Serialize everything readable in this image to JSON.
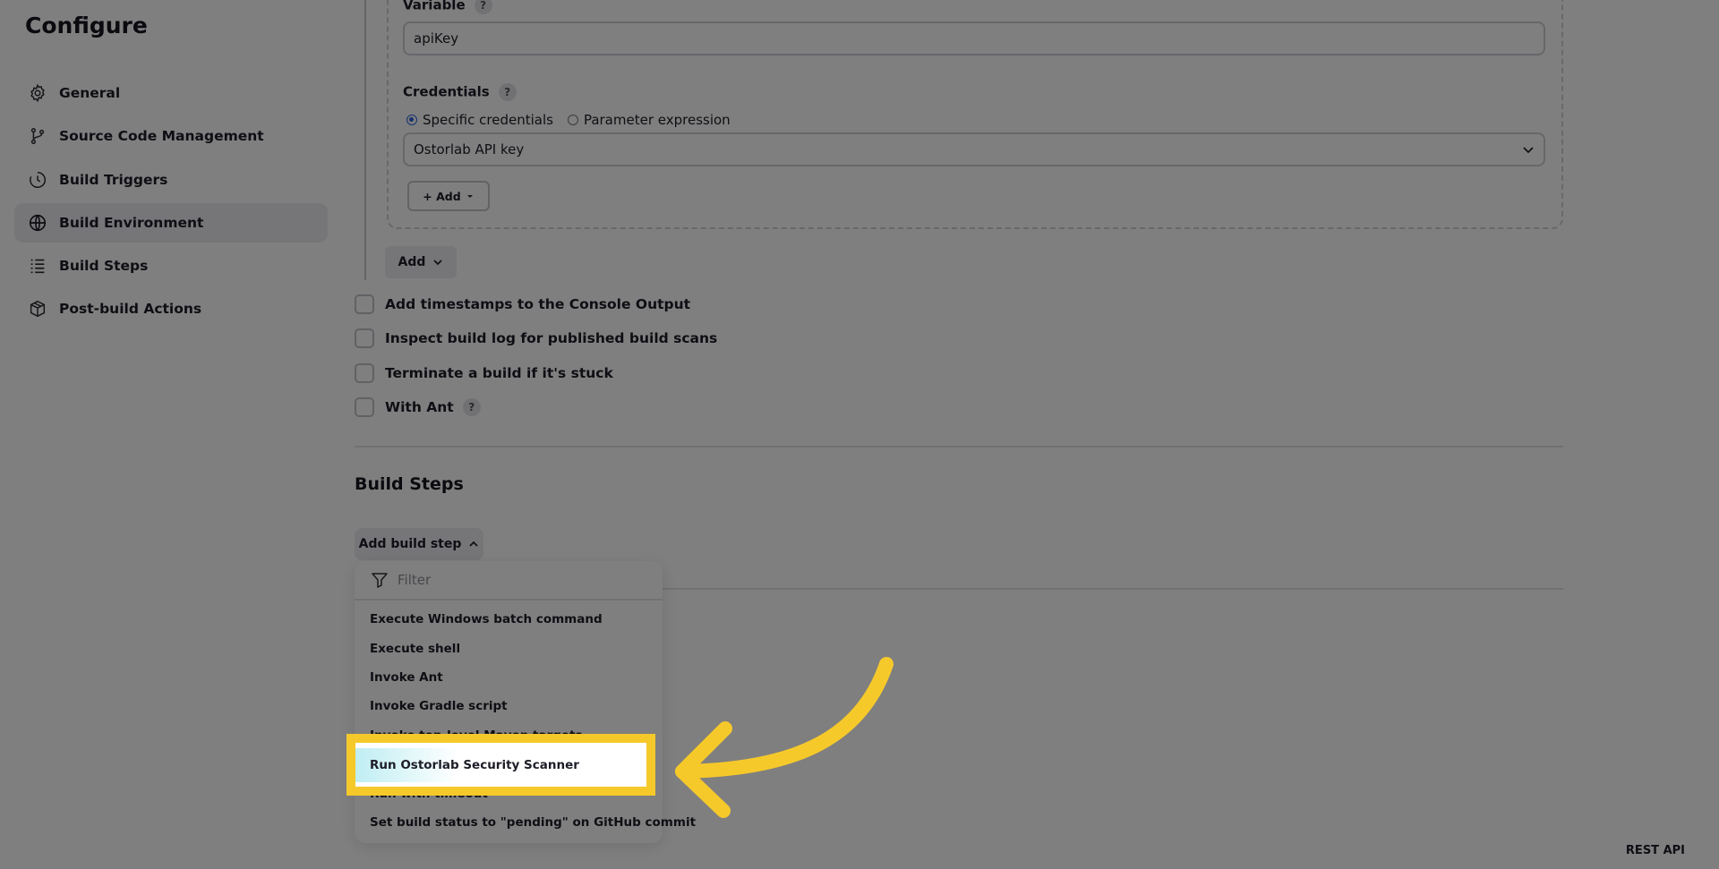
{
  "sidebar": {
    "title": "Configure",
    "items": [
      {
        "label": "General",
        "icon": "gear-icon"
      },
      {
        "label": "Source Code Management",
        "icon": "git-branch-icon"
      },
      {
        "label": "Build Triggers",
        "icon": "clock-icon"
      },
      {
        "label": "Build Environment",
        "icon": "globe-icon",
        "active": true
      },
      {
        "label": "Build Steps",
        "icon": "list-icon"
      },
      {
        "label": "Post-build Actions",
        "icon": "package-icon"
      }
    ]
  },
  "binding": {
    "variable_label": "Variable",
    "variable_value": "apiKey",
    "credentials_label": "Credentials",
    "radio_specific": "Specific credentials",
    "radio_parameter": "Parameter expression",
    "credentials_selected": "Ostorlab API key",
    "add_small": "+ Add",
    "help": "?"
  },
  "add_button": "Add",
  "checkboxes": [
    {
      "label": "Add timestamps to the Console Output"
    },
    {
      "label": "Inspect build log for published build scans"
    },
    {
      "label": "Terminate a build if it's stuck"
    },
    {
      "label": "With Ant"
    }
  ],
  "build_steps": {
    "title": "Build Steps",
    "add_step_label": "Add build step",
    "filter_placeholder": "Filter",
    "items": [
      "Execute Windows batch command",
      "Execute shell",
      "Invoke Ant",
      "Invoke Gradle script",
      "Invoke top-level Maven targets",
      "Run Ostorlab Security Scanner",
      "Run with timeout",
      "Set build status to \"pending\" on GitHub commit"
    ],
    "highlighted": "Run Ostorlab Security Scanner"
  },
  "footer": {
    "rest_api": "REST API"
  },
  "colors": {
    "highlight": "#f6c92b",
    "overlay": "rgba(0,0,0,0.5)",
    "active_nav": "#ececf1"
  }
}
